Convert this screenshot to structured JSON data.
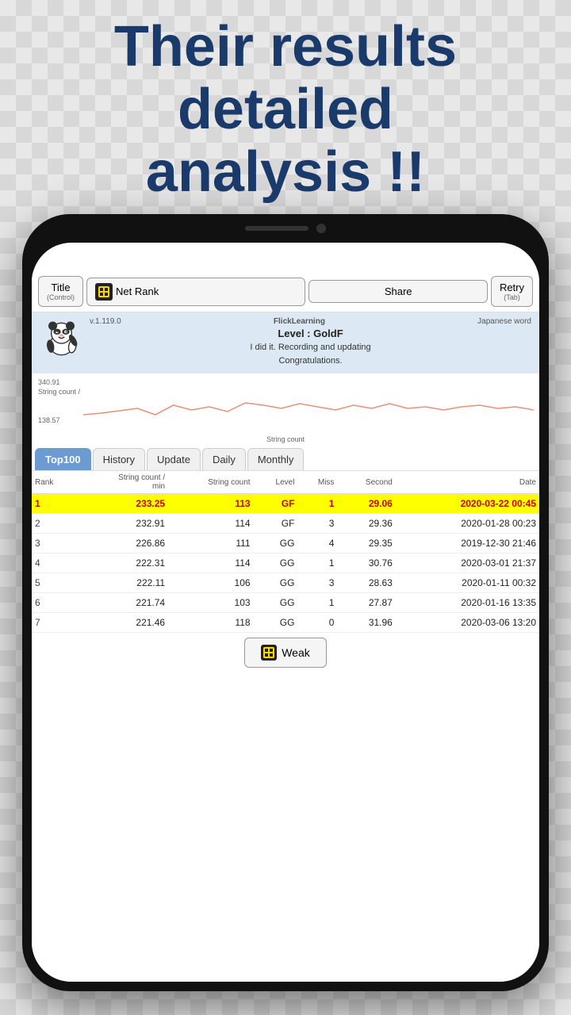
{
  "headline": {
    "line1": "Their results",
    "line2": "detailed",
    "line3": "analysis !!"
  },
  "toolbar": {
    "title_label": "Title",
    "title_sub": "(Control)",
    "net_rank_label": "Net Rank",
    "share_label": "Share",
    "retry_label": "Retry",
    "retry_sub": "(Tab)"
  },
  "info": {
    "version": "v.1.119.0",
    "app_name": "FlickLearning",
    "jp_word": "Japanese word",
    "level": "Level : GoldF",
    "congrats": "I did it. Recording and updating\nCongratulations.",
    "y_max": "340.91",
    "y_label": "String count /",
    "y_min": "138.57",
    "x_label": "String count"
  },
  "tabs": [
    {
      "label": "Top100",
      "active": true
    },
    {
      "label": "History",
      "active": false
    },
    {
      "label": "Update",
      "active": false
    },
    {
      "label": "Daily",
      "active": false
    },
    {
      "label": "Monthly",
      "active": false
    }
  ],
  "table": {
    "headers": [
      "Rank",
      "String count /\nmin",
      "String count",
      "Level",
      "Miss",
      "Second",
      "Date"
    ],
    "rows": [
      {
        "rank": "1",
        "spm": "233.25",
        "count": "113",
        "level": "GF",
        "miss": "1",
        "second": "29.06",
        "date": "2020-03-22 00:45",
        "highlight": true
      },
      {
        "rank": "2",
        "spm": "232.91",
        "count": "114",
        "level": "GF",
        "miss": "3",
        "second": "29.36",
        "date": "2020-01-28 00:23",
        "highlight": false
      },
      {
        "rank": "3",
        "spm": "226.86",
        "count": "111",
        "level": "GG",
        "miss": "4",
        "second": "29.35",
        "date": "2019-12-30 21:46",
        "highlight": false
      },
      {
        "rank": "4",
        "spm": "222.31",
        "count": "114",
        "level": "GG",
        "miss": "1",
        "second": "30.76",
        "date": "2020-03-01 21:37",
        "highlight": false
      },
      {
        "rank": "5",
        "spm": "222.11",
        "count": "106",
        "level": "GG",
        "miss": "3",
        "second": "28.63",
        "date": "2020-01-11 00:32",
        "highlight": false
      },
      {
        "rank": "6",
        "spm": "221.74",
        "count": "103",
        "level": "GG",
        "miss": "1",
        "second": "27.87",
        "date": "2020-01-16 13:35",
        "highlight": false
      },
      {
        "rank": "7",
        "spm": "221.46",
        "count": "118",
        "level": "GG",
        "miss": "0",
        "second": "31.96",
        "date": "2020-03-06 13:20",
        "highlight": false
      }
    ]
  },
  "weak_btn": {
    "label": "Weak"
  }
}
